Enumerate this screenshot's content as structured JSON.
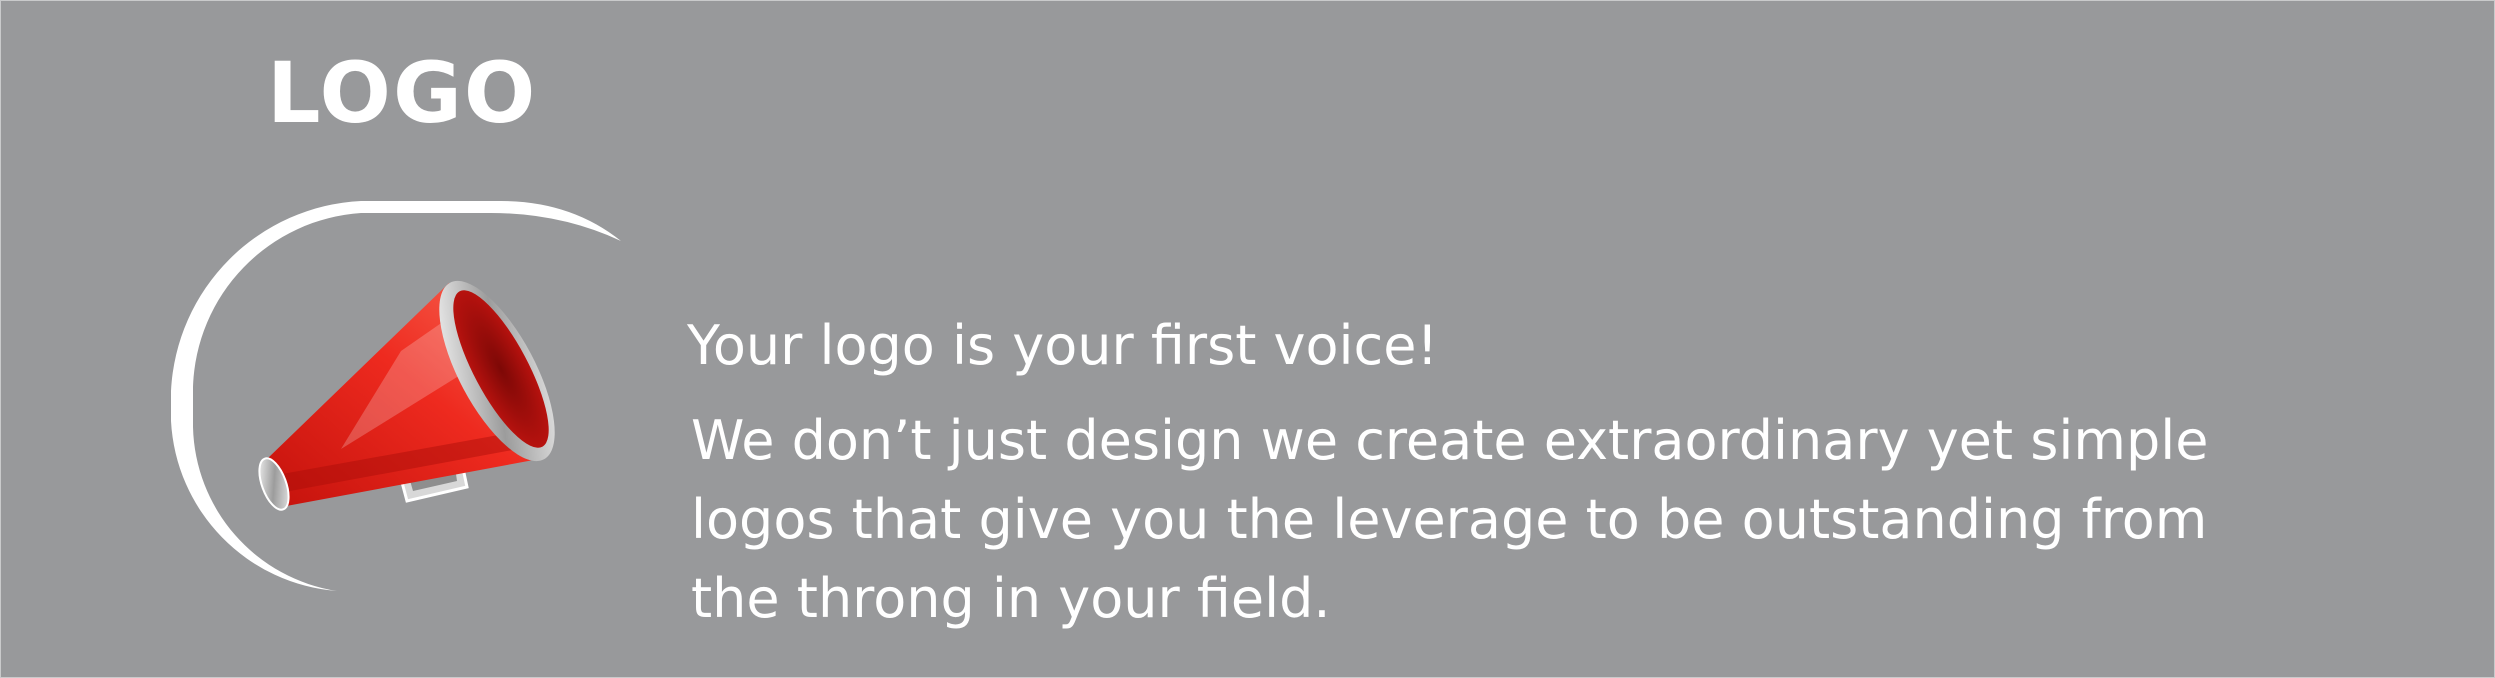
{
  "logo": {
    "text": "LOGO",
    "icon": "megaphone-icon"
  },
  "headline": "Your logo is your first voice!",
  "body": "We don’t just design we create extraordinary yet simple logos that give you the leverage to be outstanding from the throng in your field.",
  "colors": {
    "background": "#98999b",
    "text": "#ffffff",
    "megaphone": "#e3231b"
  }
}
